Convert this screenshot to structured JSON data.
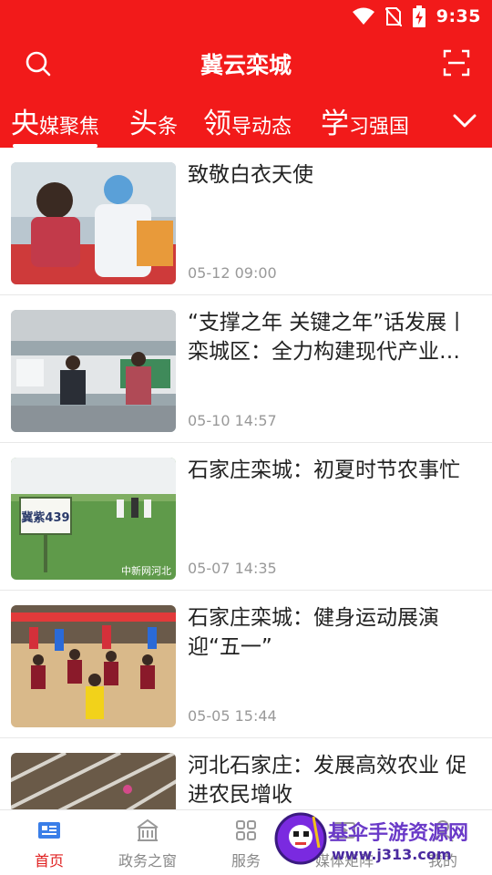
{
  "status_bar": {
    "time": "9:35",
    "icons": [
      "wifi-icon",
      "no-sim-icon",
      "battery-charging-icon"
    ]
  },
  "header": {
    "title": "冀云栾城",
    "left_icon": "search-icon",
    "right_icon": "scan-icon"
  },
  "colors": {
    "brand_red": "#f21a1a",
    "active_red": "#e02020",
    "text_dark": "#222222",
    "text_gray": "#999999"
  },
  "tabs": [
    {
      "big": "央",
      "small": "媒聚焦",
      "active": true
    },
    {
      "big": "头",
      "small": "条",
      "active": false
    },
    {
      "big": "领",
      "small": "导动态",
      "active": false
    },
    {
      "big": "学",
      "small": "习强国",
      "active": false
    }
  ],
  "tabs_more_icon": "chevron-down-icon",
  "news": [
    {
      "title": "致敬白衣天使",
      "date": "05-12 09:00"
    },
    {
      "title": "“支撑之年 关键之年”话发展丨栾城区：全力构建现代产业…",
      "date": "05-10 14:57"
    },
    {
      "title": "石家庄栾城：初夏时节农事忙",
      "date": "05-07 14:35",
      "thumb_sign": "冀紫439",
      "thumb_watermark": "中新网河北"
    },
    {
      "title": "石家庄栾城：健身运动展演迎“五一”",
      "date": "05-05 15:44"
    },
    {
      "title": "河北石家庄：发展高效农业 促进农民增收",
      "date": ""
    }
  ],
  "bottom_nav": [
    {
      "label": "首页",
      "icon": "home-news-icon",
      "active": true
    },
    {
      "label": "政务之窗",
      "icon": "government-building-icon",
      "active": false
    },
    {
      "label": "服务",
      "icon": "grid-services-icon",
      "active": false
    },
    {
      "label": "媒体矩阵",
      "icon": "media-matrix-icon",
      "active": false
    },
    {
      "label": "我的",
      "icon": "profile-icon",
      "active": false
    }
  ],
  "watermark": {
    "line1": "基伞手游资源网",
    "line2": "www.j313.com"
  }
}
